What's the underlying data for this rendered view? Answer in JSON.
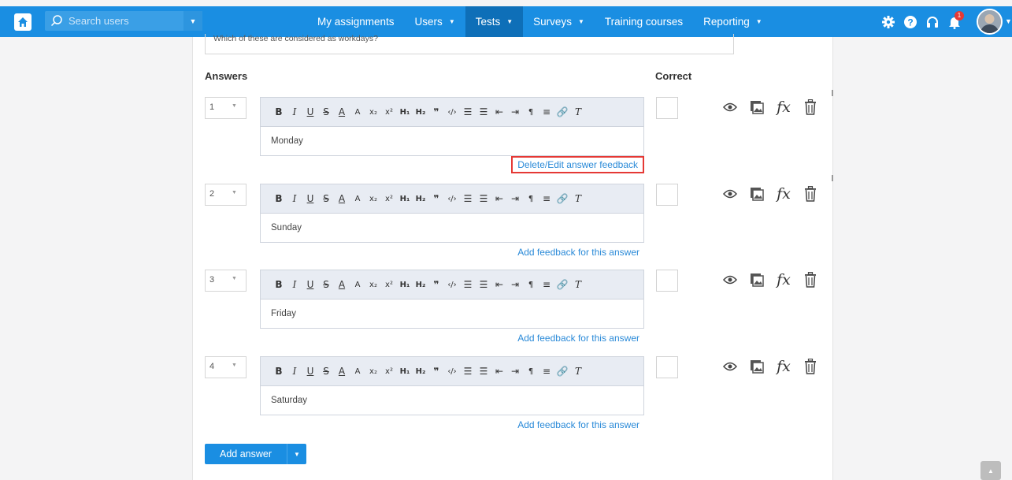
{
  "nav": {
    "search_placeholder": "Search users",
    "items": [
      {
        "label": "My assignments",
        "caret": ""
      },
      {
        "label": "Users",
        "caret": "▼"
      },
      {
        "label": "Tests",
        "caret": "▼"
      },
      {
        "label": "Surveys",
        "caret": "▼"
      },
      {
        "label": "Training courses",
        "caret": ""
      },
      {
        "label": "Reporting",
        "caret": "▼"
      }
    ],
    "active": "Tests",
    "notification_count": "1",
    "icons": [
      "gear-icon",
      "help-icon",
      "headset-icon",
      "bell-icon"
    ]
  },
  "question": {
    "text": "Which of these are considered as workdays?"
  },
  "headers": {
    "answers": "Answers",
    "correct": "Correct"
  },
  "toolbar": [
    "B",
    "I",
    "U",
    "S",
    "A",
    "A",
    "x₂",
    "x²",
    "H1",
    "H2",
    "❞",
    "‹/›",
    "ordered-list",
    "bullet-list",
    "outdent",
    "indent",
    "ltr",
    "align",
    "link",
    "clear-format"
  ],
  "answers": [
    {
      "number": "1",
      "text": "Monday",
      "feedback_link": "Delete/Edit answer feedback",
      "correct": false
    },
    {
      "number": "2",
      "text": "Sunday",
      "feedback_link": "Add feedback for this answer",
      "correct": false
    },
    {
      "number": "3",
      "text": "Friday",
      "feedback_link": "Add feedback for this answer",
      "correct": false
    },
    {
      "number": "4",
      "text": "Saturday",
      "feedback_link": "Add feedback for this answer",
      "correct": false
    }
  ],
  "add_answer_label": "Add answer",
  "colors": {
    "primary": "#1a8ee2",
    "active_nav": "#0e6fb8",
    "highlight_border": "#e53935",
    "link": "#2a8ad8"
  }
}
